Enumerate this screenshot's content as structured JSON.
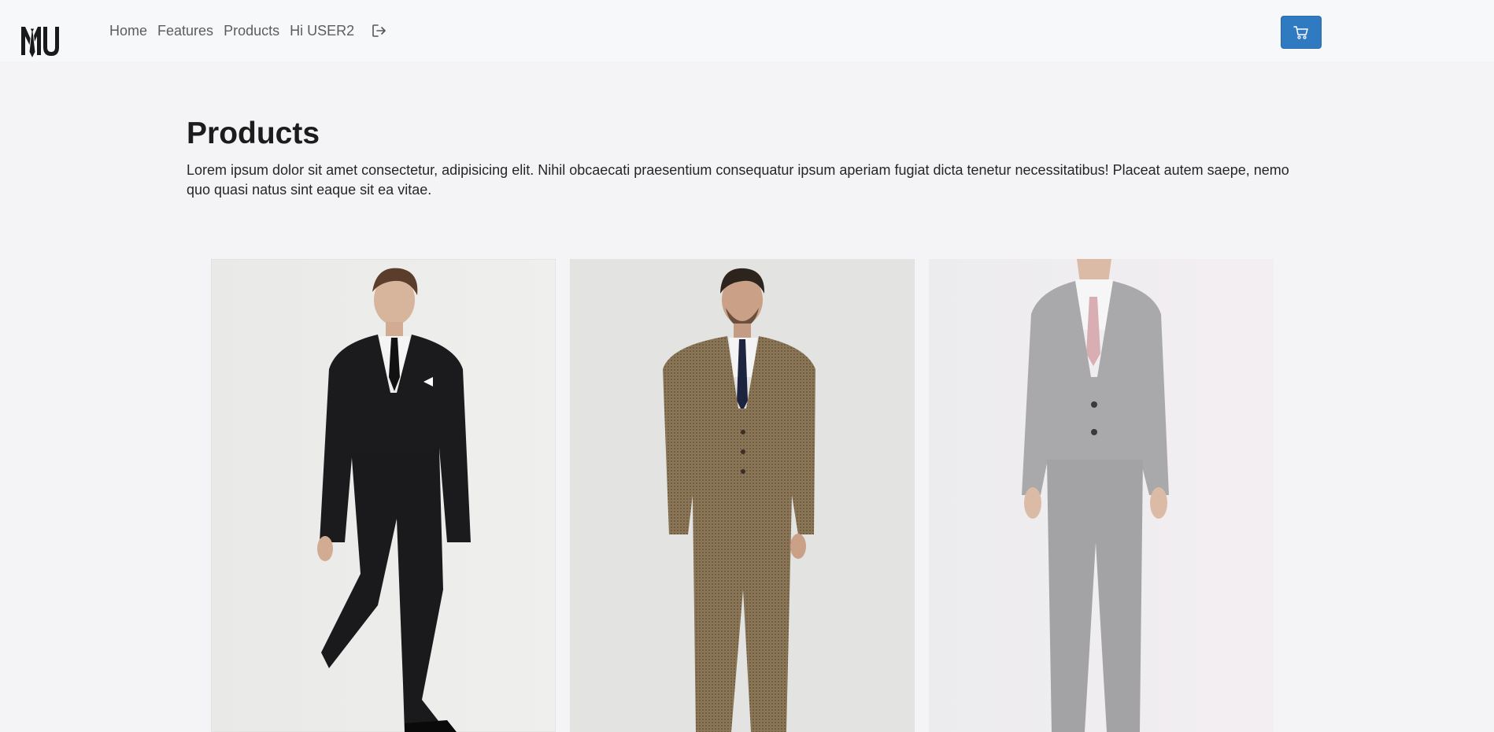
{
  "nav": {
    "logo_text": "MU",
    "links": [
      "Home",
      "Features",
      "Products",
      "Hi USER2"
    ],
    "logout_icon": "logout-icon",
    "cart_icon": "cart-icon",
    "cart_color": "#2f7ac1"
  },
  "page": {
    "title": "Products",
    "description": "Lorem ipsum dolor sit amet consectetur, adipisicing elit. Nihil obcaecati praesentium consequatur ipsum aperiam fugiat dicta tenetur necessitatibus! Placeat autem saepe, nemo quo quasi natus sint eaque sit ea vitae."
  },
  "products": [
    {
      "image": "man in black three-piece suit",
      "suit_color": "#1b1b1d",
      "tie_color": "#111111"
    },
    {
      "image": "man in brown houndstooth three-piece suit",
      "suit_color": "#8a7557",
      "tie_color": "#1c2440"
    },
    {
      "image": "man in light grey suit",
      "suit_color": "#a9a9ab",
      "tie_color": "#d8aeb3"
    }
  ]
}
